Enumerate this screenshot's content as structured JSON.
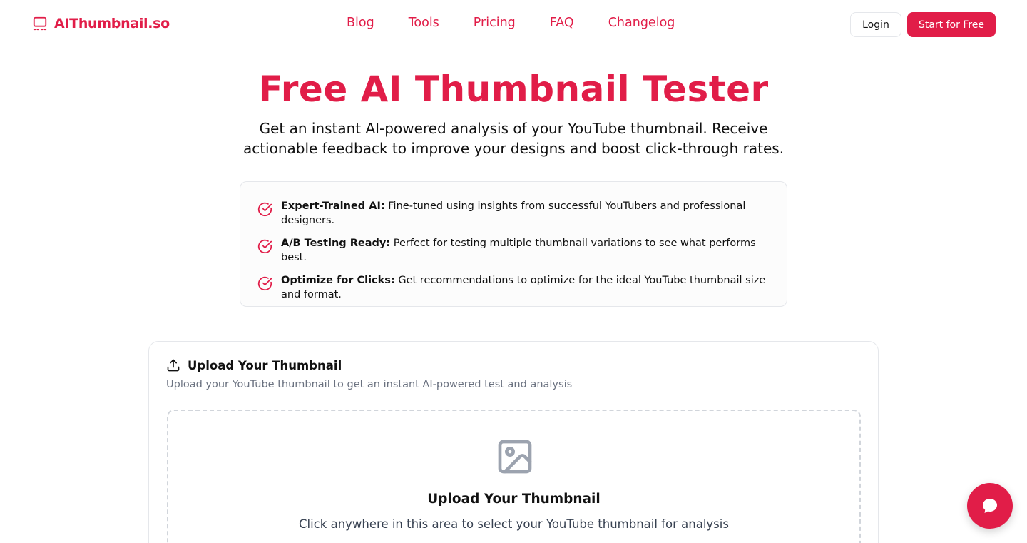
{
  "colors": {
    "accent": "#e11d48",
    "muted": "#6b7280",
    "border": "#e5e7eb"
  },
  "nav": {
    "brand": "AIThumbnail.so",
    "brand_icon": "monitor-icon",
    "links": [
      "Blog",
      "Tools",
      "Pricing",
      "FAQ",
      "Changelog"
    ],
    "login": "Login",
    "cta": "Start for Free"
  },
  "hero": {
    "title": "Free AI Thumbnail Tester",
    "subtitle": "Get an instant AI-powered analysis of your YouTube thumbnail. Receive actionable feedback to improve your designs and boost click-through rates."
  },
  "features": [
    {
      "icon": "check-circle-icon",
      "title": "Expert-Trained AI:",
      "text": "Fine-tuned using insights from successful YouTubers and professional designers."
    },
    {
      "icon": "check-circle-icon",
      "title": "A/B Testing Ready:",
      "text": "Perfect for testing multiple thumbnail variations to see what performs best."
    },
    {
      "icon": "check-circle-icon",
      "title": "Optimize for Clicks:",
      "text": "Get recommendations to optimize for the ideal YouTube thumbnail size and format."
    }
  ],
  "upload": {
    "icon": "upload-icon",
    "title": "Upload Your Thumbnail",
    "description": "Upload your YouTube thumbnail to get an instant AI-powered test and analysis",
    "dropzone": {
      "icon": "image-icon",
      "title": "Upload Your Thumbnail",
      "hint": "Click anywhere in this area to select your YouTube thumbnail for analysis"
    }
  },
  "chat": {
    "icon": "chat-bubble-icon"
  }
}
